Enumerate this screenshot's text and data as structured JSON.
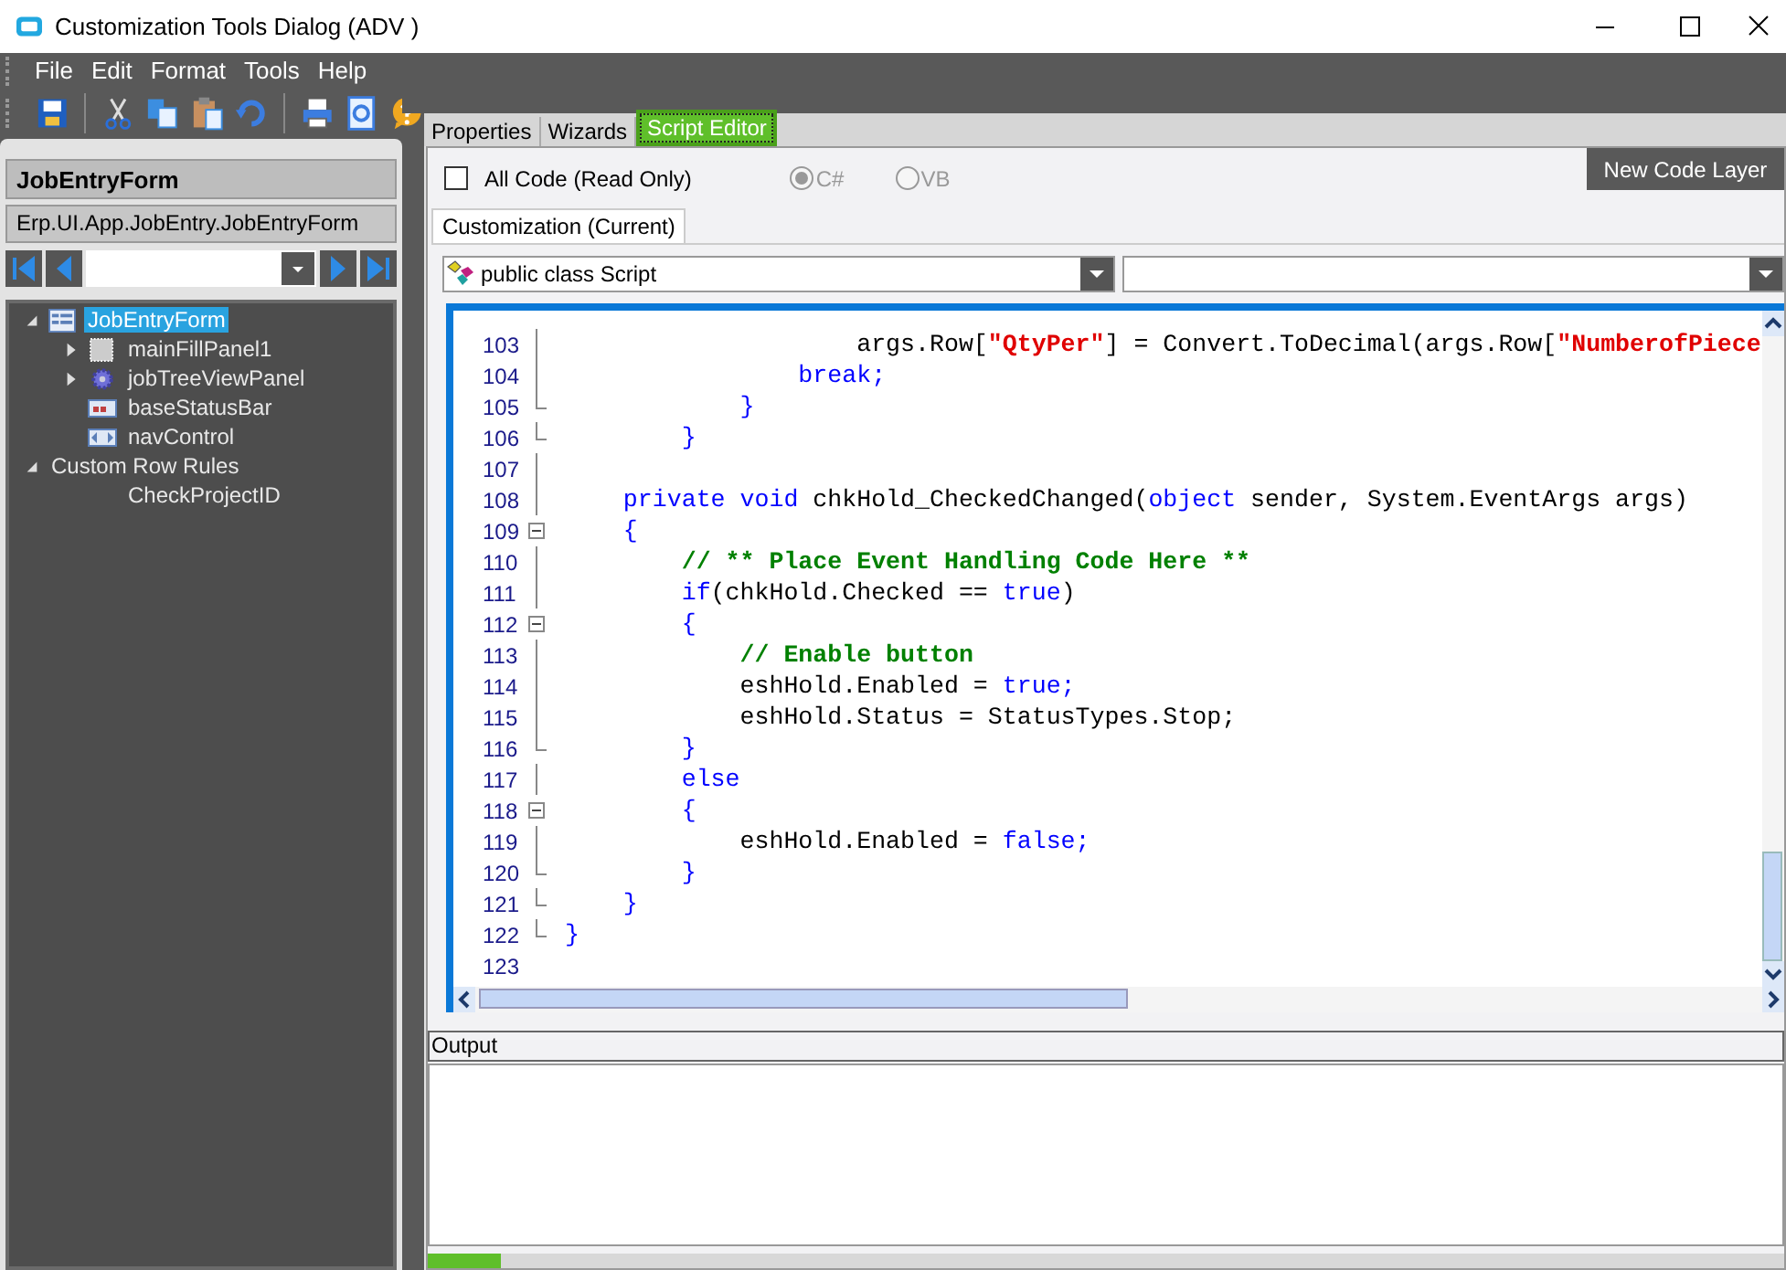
{
  "window": {
    "title": "Customization Tools Dialog  (ADV )"
  },
  "menu": [
    "File",
    "Edit",
    "Format",
    "Tools",
    "Help"
  ],
  "toolbar": [
    {
      "kind": "save"
    },
    {
      "kind": "sep"
    },
    {
      "kind": "cut"
    },
    {
      "kind": "copy"
    },
    {
      "kind": "paste"
    },
    {
      "kind": "undo"
    },
    {
      "kind": "sep"
    },
    {
      "kind": "print"
    },
    {
      "kind": "preview"
    },
    {
      "kind": "help"
    }
  ],
  "left": {
    "form_title": "JobEntryForm",
    "form_class": "Erp.UI.App.JobEntry.JobEntryForm",
    "tree": [
      {
        "label": "JobEntryForm",
        "kind": "form",
        "selected": true,
        "expanded": true,
        "children": [
          {
            "label": "mainFillPanel1",
            "kind": "panel",
            "selected": false,
            "expanded": false
          },
          {
            "label": "jobTreeViewPanel",
            "kind": "gear",
            "selected": false,
            "expanded": false
          },
          {
            "label": "baseStatusBar",
            "kind": "statusbar",
            "selected": false
          },
          {
            "label": "navControl",
            "kind": "nav",
            "selected": false
          }
        ]
      },
      {
        "label": "Custom Row Rules",
        "kind": "group",
        "selected": false,
        "expanded": true,
        "children": [
          {
            "label": "CheckProjectID",
            "kind": "rule",
            "selected": false
          }
        ]
      }
    ]
  },
  "tabs": [
    {
      "label": "Properties",
      "selected": false
    },
    {
      "label": "Wizards",
      "selected": false
    },
    {
      "label": "Script Editor",
      "selected": true
    }
  ],
  "script": {
    "all_code": {
      "label": "All Code (Read Only)",
      "checked": false
    },
    "languages": [
      {
        "label": "C#",
        "selected": true
      },
      {
        "label": "VB",
        "selected": false
      }
    ],
    "new_layer_button": "New Code Layer",
    "subtabs": [
      {
        "label": "Customization (Current)",
        "selected": true
      }
    ],
    "class_dropdown": "public class Script",
    "lines": [
      {
        "n": "103",
        "kind": "inner",
        "tokens": [
          {
            "kind": "text",
            "text": "                    args.Row["
          },
          {
            "kind": "string",
            "text": "\"QtyPer\""
          },
          {
            "kind": "text",
            "text": "] = Convert.ToDecimal(args.Row["
          },
          {
            "kind": "string",
            "text": "\"NumberofPiece"
          }
        ]
      },
      {
        "n": "104",
        "kind": "inner",
        "tokens": [
          {
            "kind": "keyword",
            "text": "                break;"
          }
        ]
      },
      {
        "n": "105",
        "kind": "end",
        "tokens": [
          {
            "kind": "keyword",
            "text": "            }"
          }
        ]
      },
      {
        "n": "106",
        "kind": "end",
        "tokens": [
          {
            "kind": "keyword",
            "text": "        }"
          }
        ]
      },
      {
        "n": "107",
        "kind": "inner"
      },
      {
        "n": "108",
        "kind": "inner",
        "tokens": [
          {
            "kind": "keyword",
            "text": "    private void"
          },
          {
            "kind": "text",
            "text": " chkHold_CheckedChanged("
          },
          {
            "kind": "keyword",
            "text": "object"
          },
          {
            "kind": "text",
            "text": " sender, System.EventArgs args)"
          }
        ]
      },
      {
        "n": "109",
        "kind": "start",
        "tokens": [
          {
            "kind": "keyword",
            "text": "    {"
          }
        ]
      },
      {
        "n": "110",
        "kind": "inner",
        "tokens": [
          {
            "kind": "comment",
            "text": "        // ** Place Event Handling Code Here **"
          }
        ]
      },
      {
        "n": "111",
        "kind": "inner",
        "tokens": [
          {
            "kind": "keyword",
            "text": "        if"
          },
          {
            "kind": "text",
            "text": "(chkHold.Checked == "
          },
          {
            "kind": "keyword",
            "text": "true"
          },
          {
            "kind": "text",
            "text": ")"
          }
        ]
      },
      {
        "n": "112",
        "kind": "start",
        "tokens": [
          {
            "kind": "keyword",
            "text": "        {"
          }
        ]
      },
      {
        "n": "113",
        "kind": "inner",
        "tokens": [
          {
            "kind": "comment",
            "text": "            // Enable button"
          }
        ]
      },
      {
        "n": "114",
        "kind": "inner",
        "tokens": [
          {
            "kind": "text",
            "text": "            eshHold.Enabled = "
          },
          {
            "kind": "keyword",
            "text": "true;"
          }
        ]
      },
      {
        "n": "115",
        "kind": "inner",
        "tokens": [
          {
            "kind": "text",
            "text": "            eshHold.Status = StatusTypes.Stop;"
          }
        ]
      },
      {
        "n": "116",
        "kind": "end",
        "tokens": [
          {
            "kind": "keyword",
            "text": "        }"
          }
        ]
      },
      {
        "n": "117",
        "kind": "inner",
        "tokens": [
          {
            "kind": "keyword",
            "text": "        else"
          }
        ]
      },
      {
        "n": "118",
        "kind": "start",
        "tokens": [
          {
            "kind": "keyword",
            "text": "        {"
          }
        ]
      },
      {
        "n": "119",
        "kind": "inner",
        "tokens": [
          {
            "kind": "text",
            "text": "            eshHold.Enabled = "
          },
          {
            "kind": "keyword",
            "text": "false;"
          }
        ]
      },
      {
        "n": "120",
        "kind": "end",
        "tokens": [
          {
            "kind": "keyword",
            "text": "        }"
          }
        ]
      },
      {
        "n": "121",
        "kind": "end",
        "tokens": [
          {
            "kind": "keyword",
            "text": "    }"
          }
        ]
      },
      {
        "n": "122",
        "kind": "end",
        "tokens": [
          {
            "kind": "keyword",
            "text": "}"
          }
        ]
      },
      {
        "n": "123",
        "kind": "plain"
      }
    ]
  },
  "output": {
    "label": "Output"
  }
}
